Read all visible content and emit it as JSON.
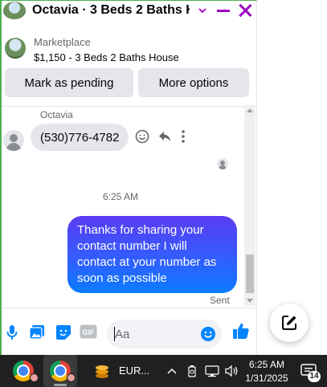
{
  "chat": {
    "title": "Octavia · 3 Beds 2 Baths H...",
    "marketplace": {
      "label": "Marketplace",
      "listing": "$1,150 - 3 Beds 2 Baths House"
    },
    "actions": {
      "mark_pending": "Mark as pending",
      "more_options": "More options"
    },
    "messages": {
      "sender_name": "Octavia",
      "incoming_text": "(530)776-4782",
      "timestamp": "6:25 AM",
      "outgoing_text": "Thanks for sharing your contact number I will contact at your number as soon as possible",
      "status": "Sent"
    },
    "composer": {
      "placeholder": "Aa"
    }
  },
  "taskbar": {
    "eur_app_label": "EUR...",
    "clock_time": "6:25 AM",
    "clock_date": "1/31/2025",
    "notification_count": "14"
  },
  "colors": {
    "accent_purple": "#a100c6",
    "messenger_blue": "#0084ff",
    "outgoing_gradient_start": "#5b3cf2",
    "window_border_green": "#4caf50",
    "taskbar_bg": "#202020"
  },
  "icons": {
    "header": [
      "listing-thumbnail",
      "chevron-down-icon",
      "minimize-icon",
      "close-icon"
    ],
    "message_actions": [
      "emoji-react-icon",
      "reply-icon",
      "more-vertical-icon"
    ],
    "composer": [
      "microphone-icon",
      "photo-icon",
      "sticker-icon",
      "gif-icon",
      "emoji-icon",
      "thumbs-up-icon"
    ],
    "fab": "compose-message-icon",
    "tray": [
      "chevron-up-icon",
      "battery-saver-icon",
      "network-icon",
      "volume-icon",
      "notification-icon"
    ]
  }
}
